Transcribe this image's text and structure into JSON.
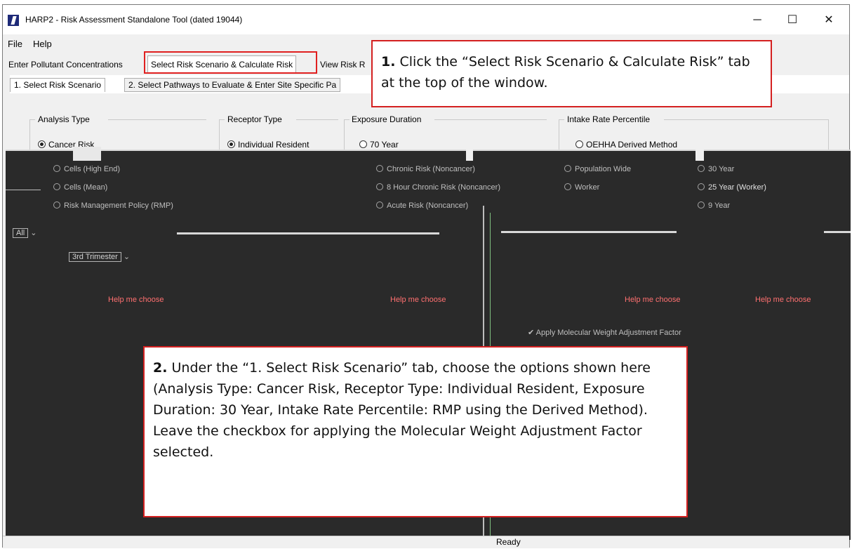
{
  "window": {
    "title": "HARP2 - Risk Assessment Standalone Tool (dated 19044)",
    "min_label": "─",
    "max_label": "☐",
    "close_label": "✕"
  },
  "menu": [
    "File",
    "Help"
  ],
  "tabs": [
    {
      "label": "Enter Pollutant Concentrations"
    },
    {
      "label": "Select Risk Scenario & Calculate Risk"
    },
    {
      "label": "View Risk R"
    }
  ],
  "subtabs": [
    {
      "label": "1. Select Risk Scenario"
    },
    {
      "label": "2. Select Pathways to Evaluate & Enter Site Specific Pa"
    }
  ],
  "groups": {
    "analysis_type": {
      "title": "Analysis Type",
      "option": "Cancer Risk"
    },
    "receptor_type": {
      "title": "Receptor Type",
      "option": "Individual Resident"
    },
    "exposure_duration": {
      "title": "Exposure Duration",
      "option": "70 Year"
    },
    "intake_rate": {
      "title": "Intake Rate Percentile",
      "option": "OEHHA Derived Method"
    }
  },
  "dark_options": [
    "Cells (High End)",
    "Cells (Mean)",
    "Risk Management Policy (RMP)",
    "Chronic Risk (Noncancer)",
    "8 Hour Chronic Risk (Noncancer)",
    "Acute Risk (Noncancer)",
    "Population Wide",
    "Worker",
    "30 Year",
    "25 Year (Worker)",
    "9 Year"
  ],
  "dropdowns": {
    "all_label": "All",
    "age_label": "3rd Trimester"
  },
  "help_link": "Help me choose",
  "mwaf_checkbox": "Apply Molecular Weight Adjustment Factor",
  "status": "Ready",
  "callouts": {
    "c1_num": "1.",
    "c1_text": "Click the “Select Risk Scenario & Calculate Risk” tab at the top of the window.",
    "c2_num": "2.",
    "c2_text": "Under the “1. Select Risk Scenario” tab, choose the options shown here (Analysis Type: Cancer Risk, Receptor Type: Individual Resident, Exposure Duration: 30 Year, Intake Rate Percentile: RMP using the Derived Method).  Leave the checkbox for applying the Molecular Weight Adjustment Factor selected."
  },
  "colors": {
    "callout_border": "#d42020",
    "help_link": "#ff7070",
    "app_icon": "#1e2a78"
  }
}
